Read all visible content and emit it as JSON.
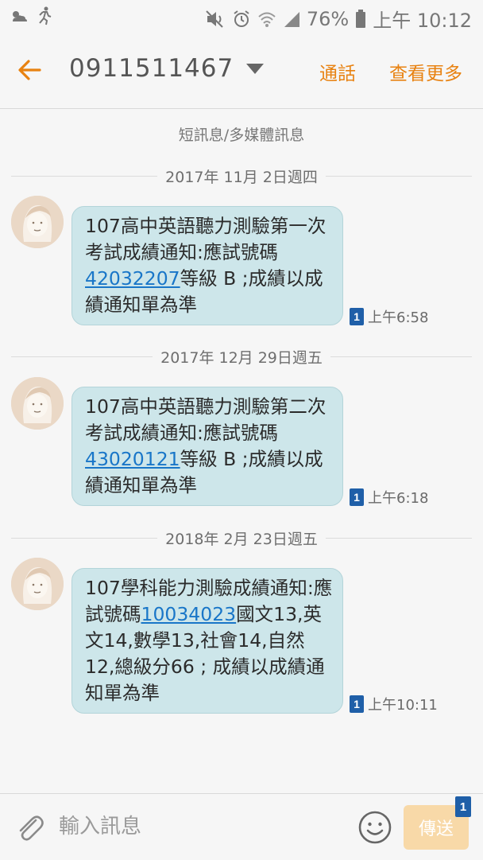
{
  "status_bar": {
    "battery": "76%",
    "time": "上午 10:12",
    "icons": [
      "weather-icon",
      "runner-icon",
      "mute-icon",
      "alarm-icon",
      "wifi-icon",
      "signal-icon",
      "battery-icon"
    ]
  },
  "app_bar": {
    "contact_number": "0911511467",
    "call_label": "通話",
    "more_label": "查看更多"
  },
  "conversation": {
    "type_label": "短訊息/多媒體訊息",
    "groups": [
      {
        "date": "2017年 11月 2日週四",
        "message": {
          "text_before": "107高中英語聽力測驗第一次考試成績通知:應試號碼",
          "link_number": "42032207",
          "text_after": "等級 B ;成績以成績通知單為準",
          "sim": "1",
          "time": "上午6:58"
        }
      },
      {
        "date": "2017年 12月 29日週五",
        "message": {
          "text_before": "107高中英語聽力測驗第二次考試成績通知:應試號碼",
          "link_number": "43020121",
          "text_after": "等級 B ;成績以成績通知單為準",
          "sim": "1",
          "time": "上午6:18"
        }
      },
      {
        "date": "2018年 2月 23日週五",
        "message": {
          "text_before": "107學科能力測驗成績通知:應試號碼",
          "link_number": "10034023",
          "text_after": "國文13,英文14,數學13,社會14,自然12,總級分66 ; 成績以成績通知單為準",
          "sim": "1",
          "time": "上午10:11"
        }
      }
    ]
  },
  "compose": {
    "placeholder": "輸入訊息",
    "send_label": "傳送",
    "send_sim": "1"
  },
  "colors": {
    "accent": "#e88211",
    "bubble": "#cde6ea",
    "link": "#1976c8",
    "sim_badge": "#1f5fa8",
    "send_disabled": "#f8d9a8"
  }
}
